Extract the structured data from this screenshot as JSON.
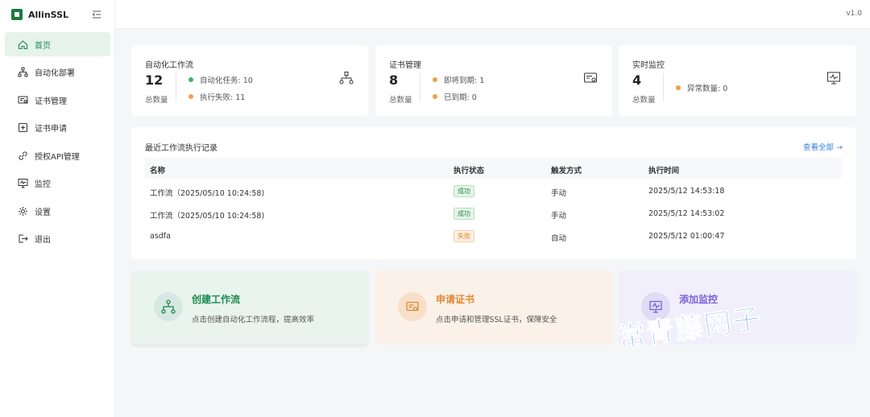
{
  "brand": {
    "name": "AllinSSL"
  },
  "header": {
    "version": "v1.0"
  },
  "sidebar": {
    "items": [
      {
        "label": "首页",
        "icon": "home-icon",
        "active": true
      },
      {
        "label": "自动化部署",
        "icon": "workflow-icon"
      },
      {
        "label": "证书管理",
        "icon": "certificate-icon"
      },
      {
        "label": "证书申请",
        "icon": "plus-square-icon"
      },
      {
        "label": "授权API管理",
        "icon": "link-icon"
      },
      {
        "label": "监控",
        "icon": "monitor-icon"
      },
      {
        "label": "设置",
        "icon": "gear-icon"
      },
      {
        "label": "退出",
        "icon": "logout-icon"
      }
    ]
  },
  "stats": {
    "workflow": {
      "title": "自动化工作流",
      "count": "12",
      "unit": "总数量",
      "row1": "自动化任务: 10",
      "row2": "执行失败: 11"
    },
    "cert": {
      "title": "证书管理",
      "count": "8",
      "unit": "总数量",
      "row1": "即将到期: 1",
      "row2": "已到期: 0"
    },
    "monitor": {
      "title": "实时监控",
      "count": "4",
      "unit": "总数量",
      "row1": "异常数量: 0"
    }
  },
  "records": {
    "title": "最近工作流执行记录",
    "view_all": "查看全部 →",
    "columns": [
      "名称",
      "执行状态",
      "触发方式",
      "执行时间"
    ],
    "rows": [
      {
        "name": "工作流（2025/05/10 10:24:58)",
        "status": "成功",
        "trigger": "手动",
        "time": "2025/5/12 14:53:18"
      },
      {
        "name": "工作流（2025/05/10 10:24:58)",
        "status": "成功",
        "trigger": "手动",
        "time": "2025/5/12 14:53:02"
      },
      {
        "name": "asdfa",
        "status": "失败",
        "trigger": "自动",
        "time": "2025/5/12 01:00:47"
      }
    ]
  },
  "actions": {
    "create_workflow": {
      "title": "创建工作流",
      "desc": "点击创建自动化工作流程，提高效率"
    },
    "apply_cert": {
      "title": "申请证书",
      "desc": "点击申请和管理SSL证书，保障安全"
    },
    "add_monitor": {
      "title": "添加监控",
      "desc": ""
    }
  },
  "watermark": "常青藤网子",
  "colors": {
    "primary": "#1e8a4f",
    "active_bg": "#e5f3ea",
    "success_dot": "#3cb371",
    "warn_dot": "#f0a04b",
    "link": "#2f7be5"
  }
}
